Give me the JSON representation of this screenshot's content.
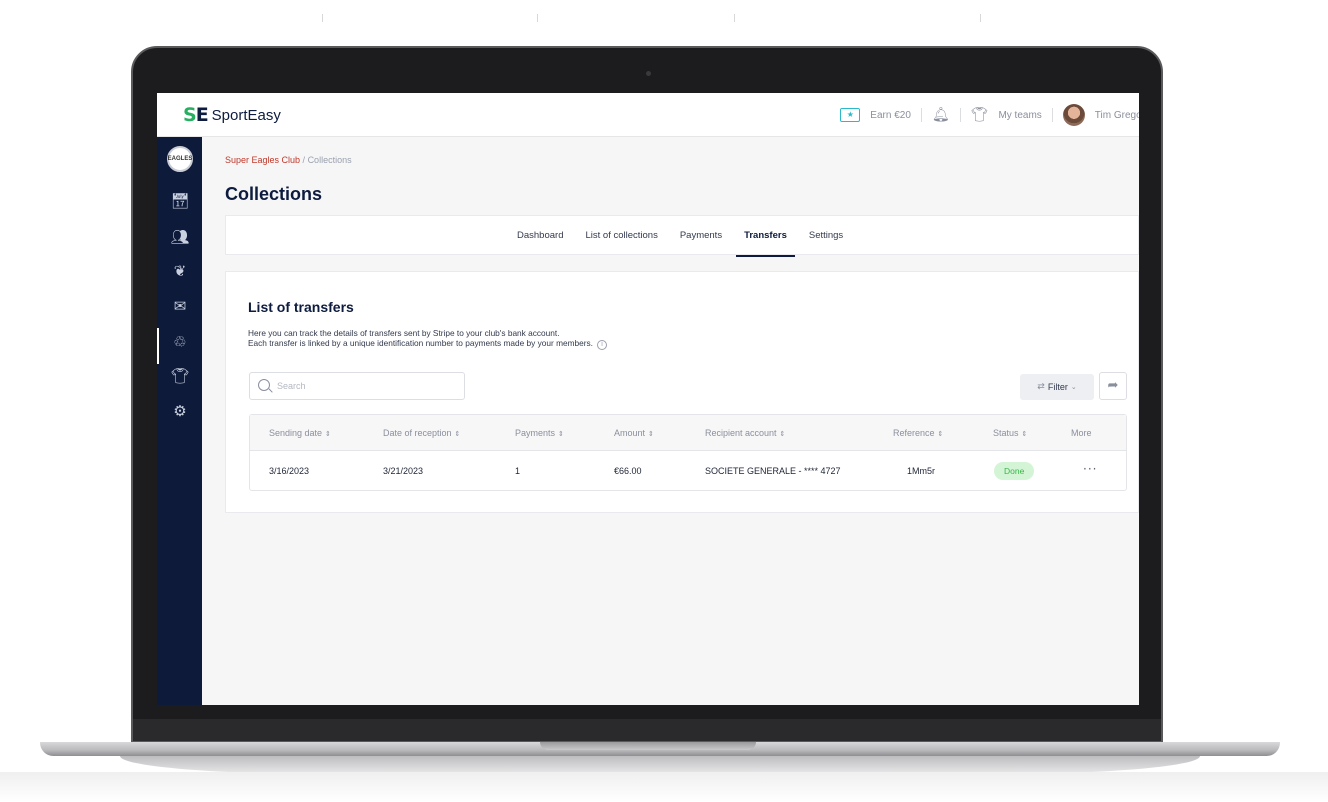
{
  "app": {
    "logo_mark_s": "S",
    "logo_mark_e": "E",
    "logo_text": "SportEasy"
  },
  "topbar": {
    "earn_label": "Earn €20",
    "my_teams_label": "My teams",
    "user_name": "Tim Gregor"
  },
  "sidebar": {
    "club_badge": "EAGLES",
    "items": [
      {
        "icon": "calendar-icon"
      },
      {
        "icon": "members-icon"
      },
      {
        "icon": "laurel-icon"
      },
      {
        "icon": "mail-icon"
      },
      {
        "icon": "hand-coin-icon",
        "active": true
      },
      {
        "icon": "shirt-icon"
      },
      {
        "icon": "gear-icon"
      }
    ]
  },
  "breadcrumb": {
    "club": "Super Eagles Club",
    "separator": " / ",
    "current": "Collections"
  },
  "page_title": "Collections",
  "tabs": [
    {
      "label": "Dashboard",
      "active": false
    },
    {
      "label": "List of collections",
      "active": false
    },
    {
      "label": "Payments",
      "active": false
    },
    {
      "label": "Transfers",
      "active": true
    },
    {
      "label": "Settings",
      "active": false
    }
  ],
  "section": {
    "title": "List of transfers",
    "desc_line1": "Here you can track the details of transfers sent by Stripe to your club's bank account.",
    "desc_line2": "Each transfer is linked by a unique identification number to payments made by your members."
  },
  "search": {
    "placeholder": "Search",
    "value": ""
  },
  "filter_label": "Filter",
  "table": {
    "columns": [
      "Sending date",
      "Date of reception",
      "Payments",
      "Amount",
      "Recipient account",
      "Reference",
      "Status",
      "More"
    ],
    "rows": [
      {
        "sending_date": "3/16/2023",
        "date_of_reception": "3/21/2023",
        "payments": "1",
        "amount": "€66.00",
        "recipient_account": "SOCIETE GENERALE - **** 4727",
        "reference": "1Mm5r",
        "status": "Done"
      }
    ]
  },
  "colors": {
    "brand_navy": "#0d1b3e",
    "brand_green": "#27ae60",
    "breadcrumb_red": "#c0392b",
    "status_done_bg": "#d4f4d6",
    "status_done_text": "#3bb54a"
  }
}
